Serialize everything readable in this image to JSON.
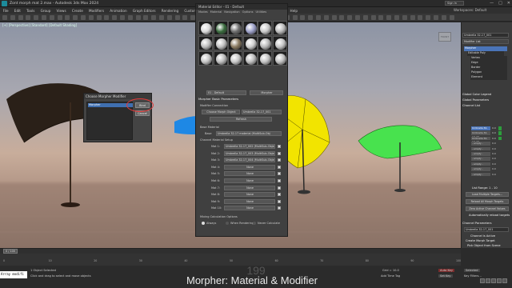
{
  "app": {
    "title": "Zont morph mat 2.max - Autodesk 3ds Max 2024",
    "signin": "Sign In",
    "workspace": "Workspaces: Default",
    "winbtns": [
      "—",
      "□",
      "✕"
    ]
  },
  "menubar": [
    "File",
    "Edit",
    "Tools",
    "Group",
    "Views",
    "Create",
    "Modifiers",
    "Animation",
    "Graph Editors",
    "Rendering",
    "Customize",
    "Scripting",
    "Substance",
    "Civil View",
    "Arnold",
    "Help"
  ],
  "viewport": {
    "label": "[+] [Perspective] [Standard] [Default Shading]",
    "viewcube_label": "FRONT"
  },
  "morpher_dialog": {
    "title": "Choose Morpher Modifier",
    "list_item": "Morpher",
    "bind_label": "Bind",
    "cancel_label": "Cancel"
  },
  "material_editor": {
    "title": "Material Editor - 01 - Default",
    "menu": [
      "Modes",
      "Material",
      "Navigation",
      "Options",
      "Utilities"
    ],
    "material_name": "01 - Default",
    "material_type": "Morpher",
    "section_params": "Morpher Basic Parameters",
    "modifier_connection": "Modifier Connection",
    "choose_morph_object": "Choose Morph Object",
    "morph_object_value": "Umbrella 32-17_001",
    "refresh": "Refresh",
    "base_material_label": "Base Material",
    "base_label": "Base",
    "base_value": "Umbrella 32-17 material (MultiSub-Obj",
    "channel_setup": "Channel Material Setup",
    "mats": [
      {
        "label": "Mat 1:",
        "value": "Umbrella 32-17_002 (MultiSub-Object)"
      },
      {
        "label": "Mat 2:",
        "value": "Umbrella 32-17_003 (MultiSub-Object)"
      },
      {
        "label": "Mat 3:",
        "value": "Umbrella 32-17_004 (MultiSub-Object)"
      },
      {
        "label": "Mat 4:",
        "value": "None"
      },
      {
        "label": "Mat 5:",
        "value": "None"
      },
      {
        "label": "Mat 6:",
        "value": "None"
      },
      {
        "label": "Mat 7:",
        "value": "None"
      },
      {
        "label": "Mat 8:",
        "value": "None"
      },
      {
        "label": "Mat 9:",
        "value": "None"
      },
      {
        "label": "Mat 10:",
        "value": "None"
      }
    ],
    "mixing_options": "Mixing Calculation Options",
    "mix_always": "Always",
    "mix_rendering": "When Rendering",
    "mix_never": "Never Calculate",
    "slot_colors": [
      "#d9d9d9",
      "#3a6c3e",
      "#6e6e6e",
      "#9ca0c8",
      "#c8c8c8",
      "#bbbbbb",
      "#bdbdbd",
      "#c0c0c0",
      "#8a7a60",
      "#cfcfcf",
      "#b8b8b8",
      "#c4c4c4",
      "#c2c2c2",
      "#bababa",
      "#c5c5c5",
      "#bcbcbc",
      "#c1c1c1",
      "#bebebe"
    ]
  },
  "right_panel": {
    "object_name": "Umbrella 32-17_001",
    "modifier_list": "Modifier List",
    "stack": [
      "Morpher",
      "Editable Poly",
      "Vertex",
      "Edge",
      "Border",
      "Polygon",
      "Element"
    ],
    "global_color": "Global Color Legend",
    "global_params": "Global Parameters",
    "channel_list": "Channel List",
    "channels": [
      {
        "name": "Umbrella 32-17_00",
        "val": "0.0"
      },
      {
        "name": "Umbrella 32-17_00",
        "val": "0.0"
      },
      {
        "name": "Umbrella 32-17_00",
        "val": "0.0"
      },
      {
        "name": "- empty -",
        "val": "0.0"
      },
      {
        "name": "- empty -",
        "val": "0.0"
      },
      {
        "name": "- empty -",
        "val": "0.0"
      },
      {
        "name": "- empty -",
        "val": "0.0"
      },
      {
        "name": "- empty -",
        "val": "0.0"
      },
      {
        "name": "- empty -",
        "val": "0.0"
      },
      {
        "name": "- empty -",
        "val": "0.0"
      }
    ],
    "list_range": "List Range: 1 - 10",
    "load_targets": "Load Multiple Targets...",
    "reload_targets": "Reload All Morph Targets",
    "zero_active": "Zero Active Channel Values",
    "auto_reload": "Automatically reload targets",
    "channel_params": "Channel Parameters",
    "channel_active": "Channel is Active",
    "create_target": "Create Morph Target",
    "pick_object": "Pick Object from Scene",
    "capture": "Capture Current State"
  },
  "timeline": {
    "frame": "0 / 100",
    "ticks": [
      "0",
      "10",
      "20",
      "30",
      "40",
      "50",
      "60",
      "70",
      "80",
      "90",
      "100"
    ]
  },
  "status": {
    "maxscript": "Array modifi",
    "selected": "1 Object Selected",
    "hint": "Click and drag to select and move objects",
    "frame_number": "199",
    "caption": "Morpher: Material & Modifier",
    "auto_key": "Auto Key",
    "set_key": "Set Key",
    "selected_mode": "Selected",
    "key_filters": "Key Filters...",
    "add_time_tag": "Add Time Tag",
    "grid": "Grid = 10.0"
  },
  "colors": {
    "accent": "#4a74b8",
    "umbrella_yellow": "#f2e400",
    "umbrella_green": "#48e24e",
    "umbrella_blue": "#1e88e5",
    "umbrella_dark": "#2a2018",
    "red_highlight": "#e23a3a"
  }
}
